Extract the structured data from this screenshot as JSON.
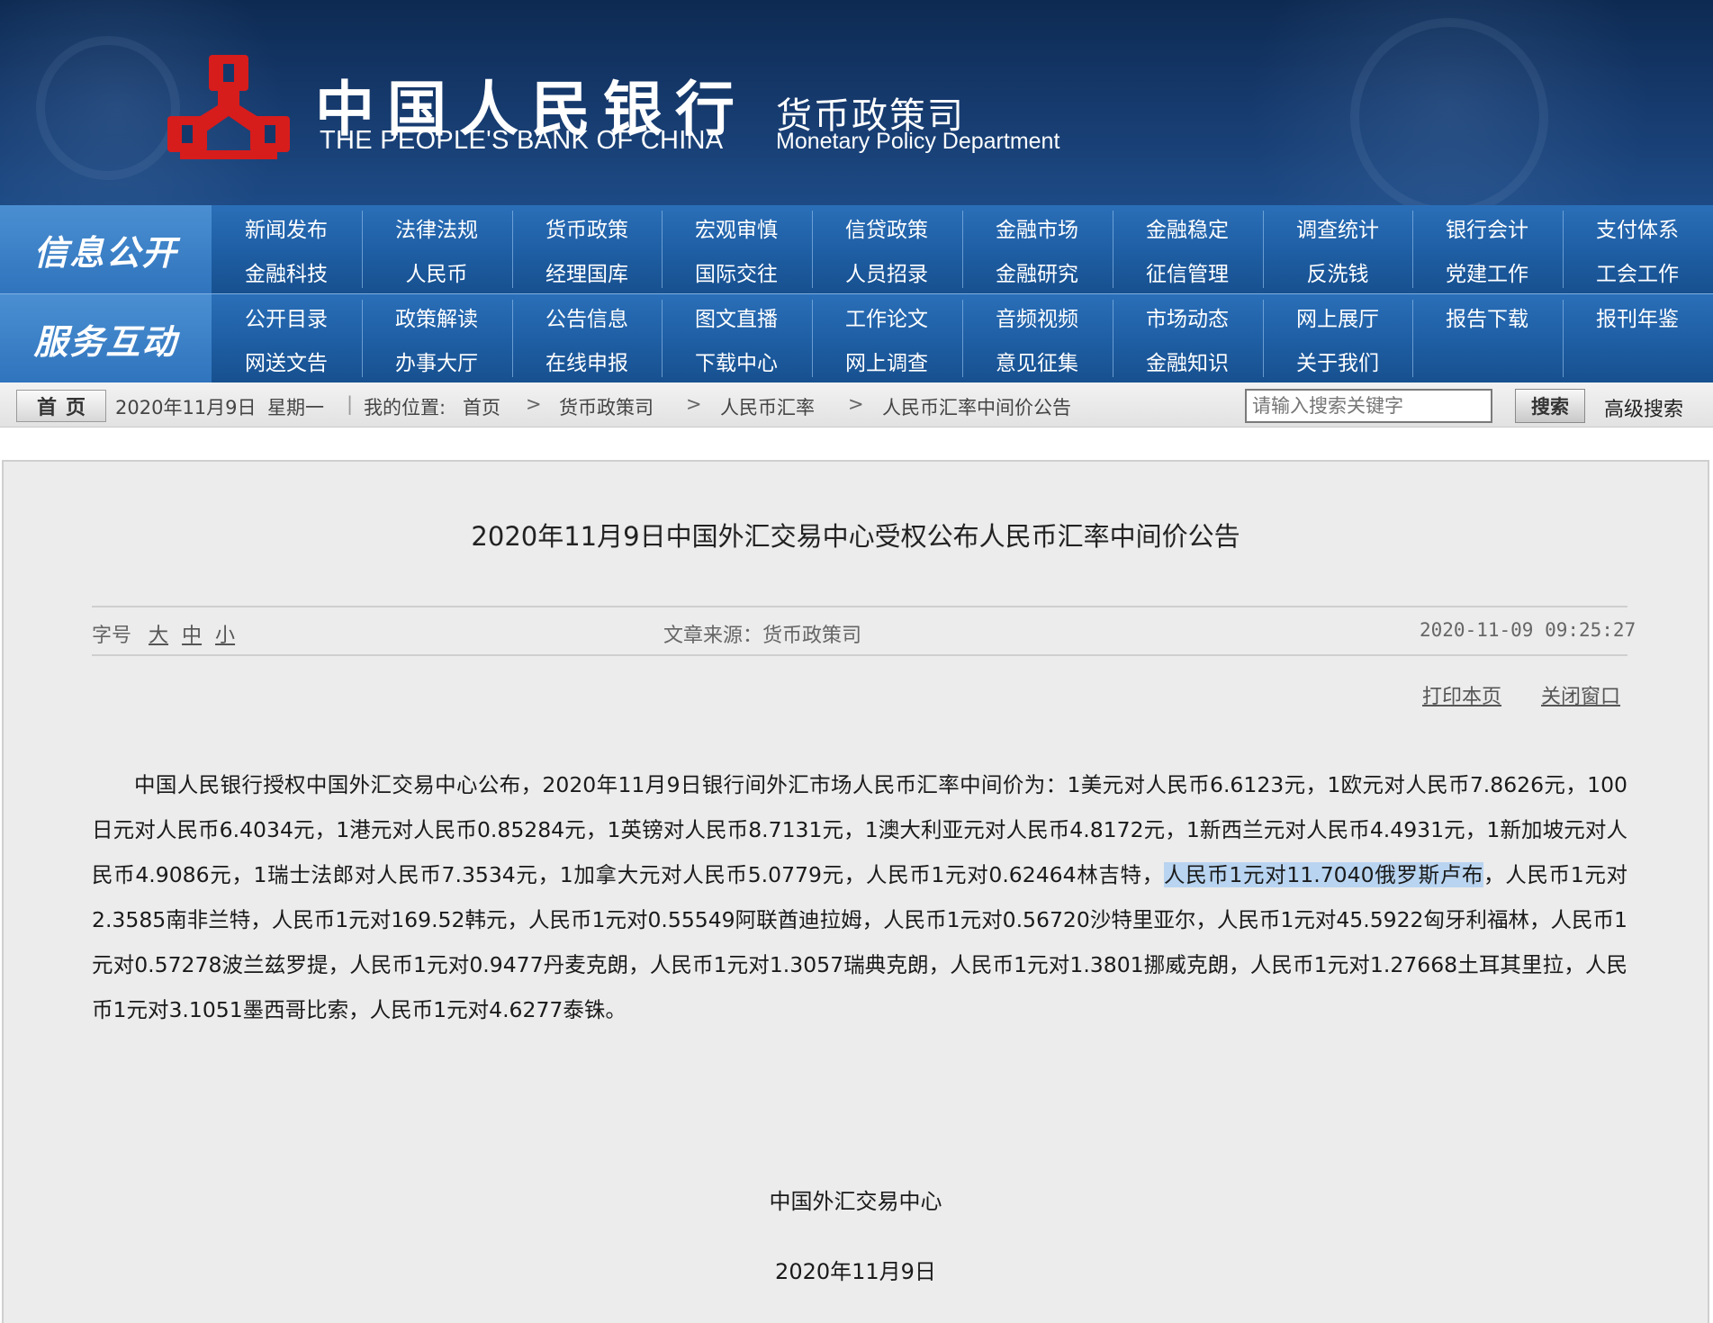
{
  "banner": {
    "bank_cn": "中国人民银行",
    "bank_en": "THE PEOPLE'S BANK OF CHINA",
    "dept_cn": "货币政策司",
    "dept_en": "Monetary Policy Department",
    "emblem_color": "#d71c1c"
  },
  "nav": {
    "section1_title": "信息公开",
    "section1_row1": [
      "新闻发布",
      "法律法规",
      "货币政策",
      "宏观审慎",
      "信贷政策",
      "金融市场",
      "金融稳定",
      "调查统计",
      "银行会计",
      "支付体系"
    ],
    "section1_row2": [
      "金融科技",
      "人民币",
      "经理国库",
      "国际交往",
      "人员招录",
      "金融研究",
      "征信管理",
      "反洗钱",
      "党建工作",
      "工会工作"
    ],
    "section2_title": "服务互动",
    "section2_row1": [
      "公开目录",
      "政策解读",
      "公告信息",
      "图文直播",
      "工作论文",
      "音频视频",
      "市场动态",
      "网上展厅",
      "报告下载",
      "报刊年鉴"
    ],
    "section2_row2": [
      "网送文告",
      "办事大厅",
      "在线申报",
      "下载中心",
      "网上调查",
      "意见征集",
      "金融知识",
      "关于我们"
    ]
  },
  "crumbbar": {
    "home": "首页",
    "date": "2020年11月9日",
    "weekday": "星期一",
    "sep": "|",
    "location_label": "我的位置:",
    "crumbs": [
      "首页",
      "货币政策司",
      "人民币汇率",
      "人民币汇率中间价公告"
    ],
    "arrow": ">",
    "search_placeholder": "请输入搜索关键字",
    "search_button": "搜索",
    "advanced_search": "高级搜索"
  },
  "article": {
    "title": "2020年11月9日中国外汇交易中心受权公布人民币汇率中间价公告",
    "font_label": "字号",
    "font_large": "大",
    "font_medium": "中",
    "font_small": "小",
    "source": "文章来源：货币政策司",
    "timestamp": "2020-11-09  09:25:27",
    "print": "打印本页",
    "close": "关闭窗口",
    "body_before": "中国人民银行授权中国外汇交易中心公布，2020年11月9日银行间外汇市场人民币汇率中间价为：1美元对人民币6.6123元，1欧元对人民币7.8626元，100日元对人民币6.4034元，1港元对人民币0.85284元，1英镑对人民币8.7131元，1澳大利亚元对人民币4.8172元，1新西兰元对人民币4.4931元，1新加坡元对人民币4.9086元，1瑞士法郎对人民币7.3534元，1加拿大元对人民币5.0779元，人民币1元对0.62464林吉特，",
    "body_highlight": "人民币1元对11.7040俄罗斯卢布",
    "body_after": "，人民币1元对2.3585南非兰特，人民币1元对169.52韩元，人民币1元对0.55549阿联酋迪拉姆，人民币1元对0.56720沙特里亚尔，人民币1元对45.5922匈牙利福林，人民币1元对0.57278波兰兹罗提，人民币1元对0.9477丹麦克朗，人民币1元对1.3057瑞典克朗，人民币1元对1.3801挪威克朗，人民币1元对1.27668土耳其里拉，人民币1元对3.1051墨西哥比索，人民币1元对4.6277泰铢。",
    "signature": "中国外汇交易中心",
    "sign_date": "2020年11月9日"
  }
}
